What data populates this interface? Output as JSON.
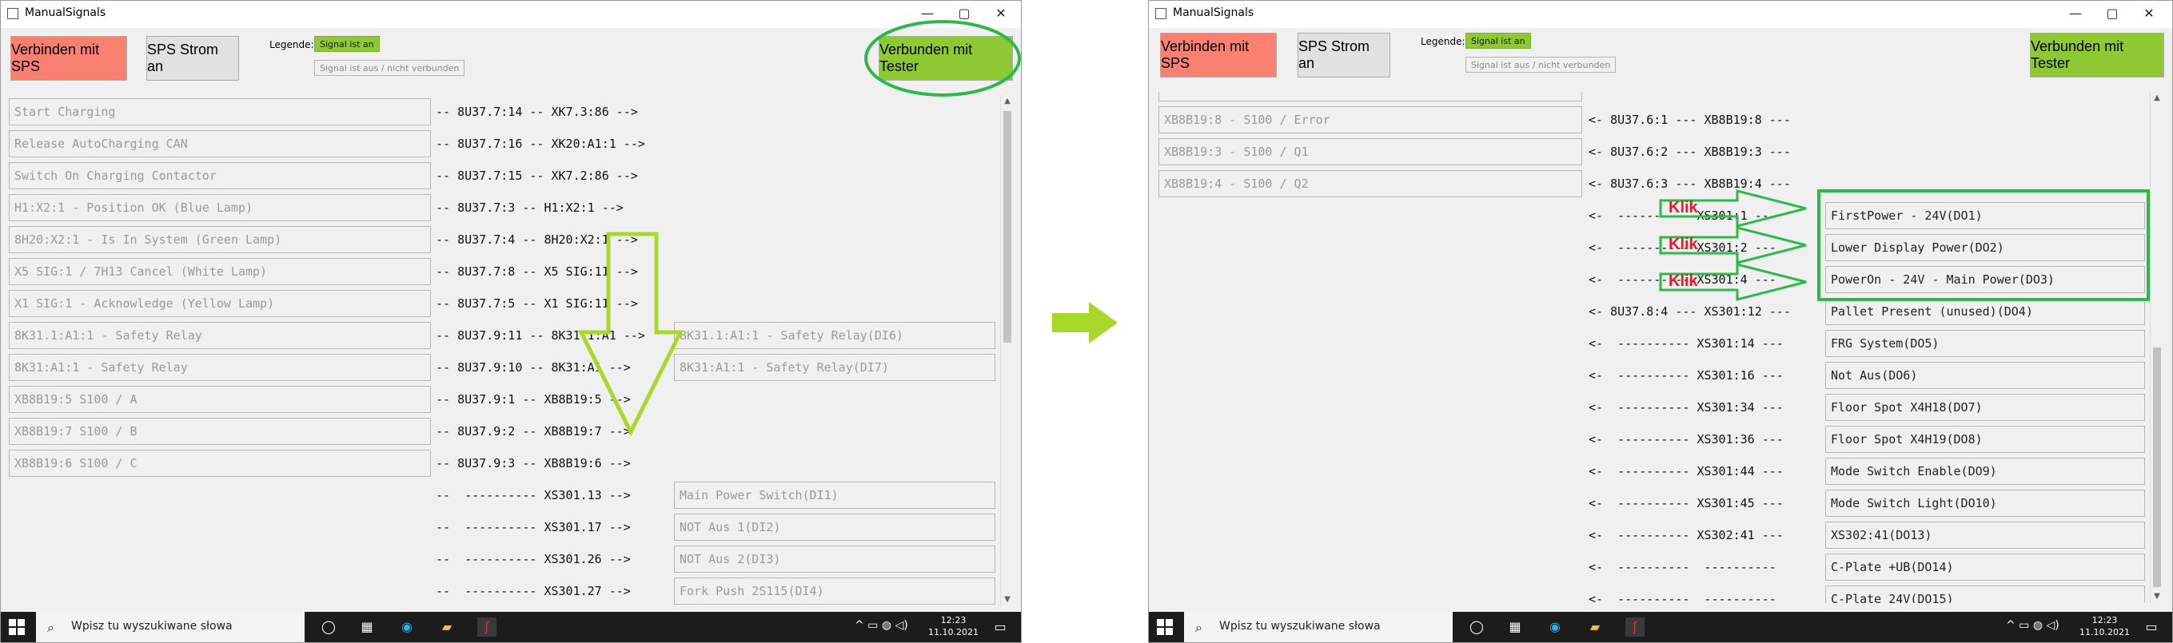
{
  "window_title": "ManualSignals",
  "window_controls": {
    "minimize": "—",
    "maximize": "▢",
    "close": "✕"
  },
  "buttons": {
    "connect_sps": "Verbinden mit SPS",
    "sps_power": "SPS Strom an",
    "connected_tester": "Verbunden mit Tester"
  },
  "legend": {
    "label": "Legende:",
    "on": "Signal ist an",
    "off": "Signal ist aus / nicht verbunden"
  },
  "colors": {
    "connect_sps_bg": "#fa8072",
    "tester_bg": "#8ec832",
    "annotation_green": "#2db84a",
    "arrow_yellow_green": "#a8d82a",
    "klik_red": "#e21d2b"
  },
  "left": {
    "inputs": [
      "Start Charging",
      "Release AutoCharging CAN",
      "Switch On Charging Contactor",
      "H1:X2:1 - Position OK (Blue Lamp)",
      "8H20:X2:1 - Is In System (Green Lamp)",
      "X5 SIG:1 / 7H13 Cancel (White Lamp)",
      "X1 SIG:1 -  Acknowledge (Yellow Lamp)",
      "8K31.1:A1:1 - Safety Relay",
      "8K31:A1:1 - Safety Relay",
      "XB8B19:5 S100 / A",
      "XB8B19:7 S100 / B",
      "XB8B19:6 S100 / C"
    ],
    "paths": [
      "-- 8U37.7:14 -- XK7.3:86 -->",
      "-- 8U37.7:16 -- XK20:A1:1 -->",
      "-- 8U37.7:15 -- XK7.2:86 -->",
      "-- 8U37.7:3 -- H1:X2:1 -->",
      "-- 8U37.7:4 -- 8H20:X2:1 -->",
      "-- 8U37.7:8 -- X5 SIG:11 -->",
      "-- 8U37.7:5 -- X1 SIG:11 -->",
      "-- 8U37.9:11 -- 8K31.1:A1 -->",
      "-- 8U37.9:10 -- 8K31:A1 -->",
      "-- 8U37.9:1 -- XB8B19:5 -->",
      "-- 8U37.9:2 -- XB8B19:7 -->",
      "-- 8U37.9:3 -- XB8B19:6 -->",
      "--  ---------- XS301.13 -->",
      "--  ---------- XS301.17 -->",
      "--  ---------- XS301.26 -->",
      "--  ---------- XS301.27 -->"
    ],
    "outputs": [
      {
        "row": 7,
        "label": "8K31.1:A1:1 - Safety Relay(DI6)"
      },
      {
        "row": 8,
        "label": "8K31:A1:1 - Safety Relay(DI7)"
      },
      {
        "row": 12,
        "label": "Main Power Switch(DI1)"
      },
      {
        "row": 13,
        "label": "NOT Aus 1(DI2)"
      },
      {
        "row": 14,
        "label": "NOT Aus 2(DI3)"
      },
      {
        "row": 15,
        "label": "Fork Push 2S115(DI4)"
      }
    ]
  },
  "right": {
    "inputs": [
      "XB8B19:8 - S100 / Error",
      "XB8B19:3 - S100 / Q1",
      "XB8B19:4 - S100 / Q2"
    ],
    "paths": [
      "<- 8U37.6:1 --- XB8B19:8 ---",
      "<- 8U37.6:2 --- XB8B19:3 ---",
      "<- 8U37.6:3 --- XB8B19:4 ---",
      "<-  ---------- XS301:1 ---",
      "<-  ---------- XS301:2 ---",
      "<-  ---------- XS301:4 ---",
      "<- 8U37.8:4 --- XS301:12 ---",
      "<-  ---------- XS301:14 ---",
      "<-  ---------- XS301:16 ---",
      "<-  ---------- XS301:34 ---",
      "<-  ---------- XS301:36 ---",
      "<-  ---------- XS301:44 ---",
      "<-  ---------- XS301:45 ---",
      "<-  ---------- XS302:41 ---",
      "<-  ----------  ----------",
      "<-  ----------  ----------"
    ],
    "outputs": [
      "FirstPower - 24V(DO1)",
      "Lower Display Power(DO2)",
      "PowerOn - 24V - Main Power(DO3)",
      "Pallet Present (unused)(DO4)",
      "FRG System(DO5)",
      "Not Aus(DO6)",
      "Floor Spot X4H18(DO7)",
      "Floor Spot X4H19(DO8)",
      "Mode Switch Enable(DO9)",
      "Mode Switch Light(DO10)",
      "XS302:41(DO13)",
      "C-Plate +UB(DO14)",
      "C-Plate 24V(DO15)"
    ],
    "klik": [
      "Klik",
      "Klik",
      "Klik"
    ]
  },
  "taskbar": {
    "search_placeholder": "Wpisz tu wyszukiwane słowa",
    "time": "12:23",
    "date": "11.10.2021",
    "icons": [
      "windows-start-icon",
      "search-icon",
      "task-view-icon",
      "widgets-icon",
      "edge-icon",
      "explorer-icon",
      "app-icon"
    ]
  }
}
